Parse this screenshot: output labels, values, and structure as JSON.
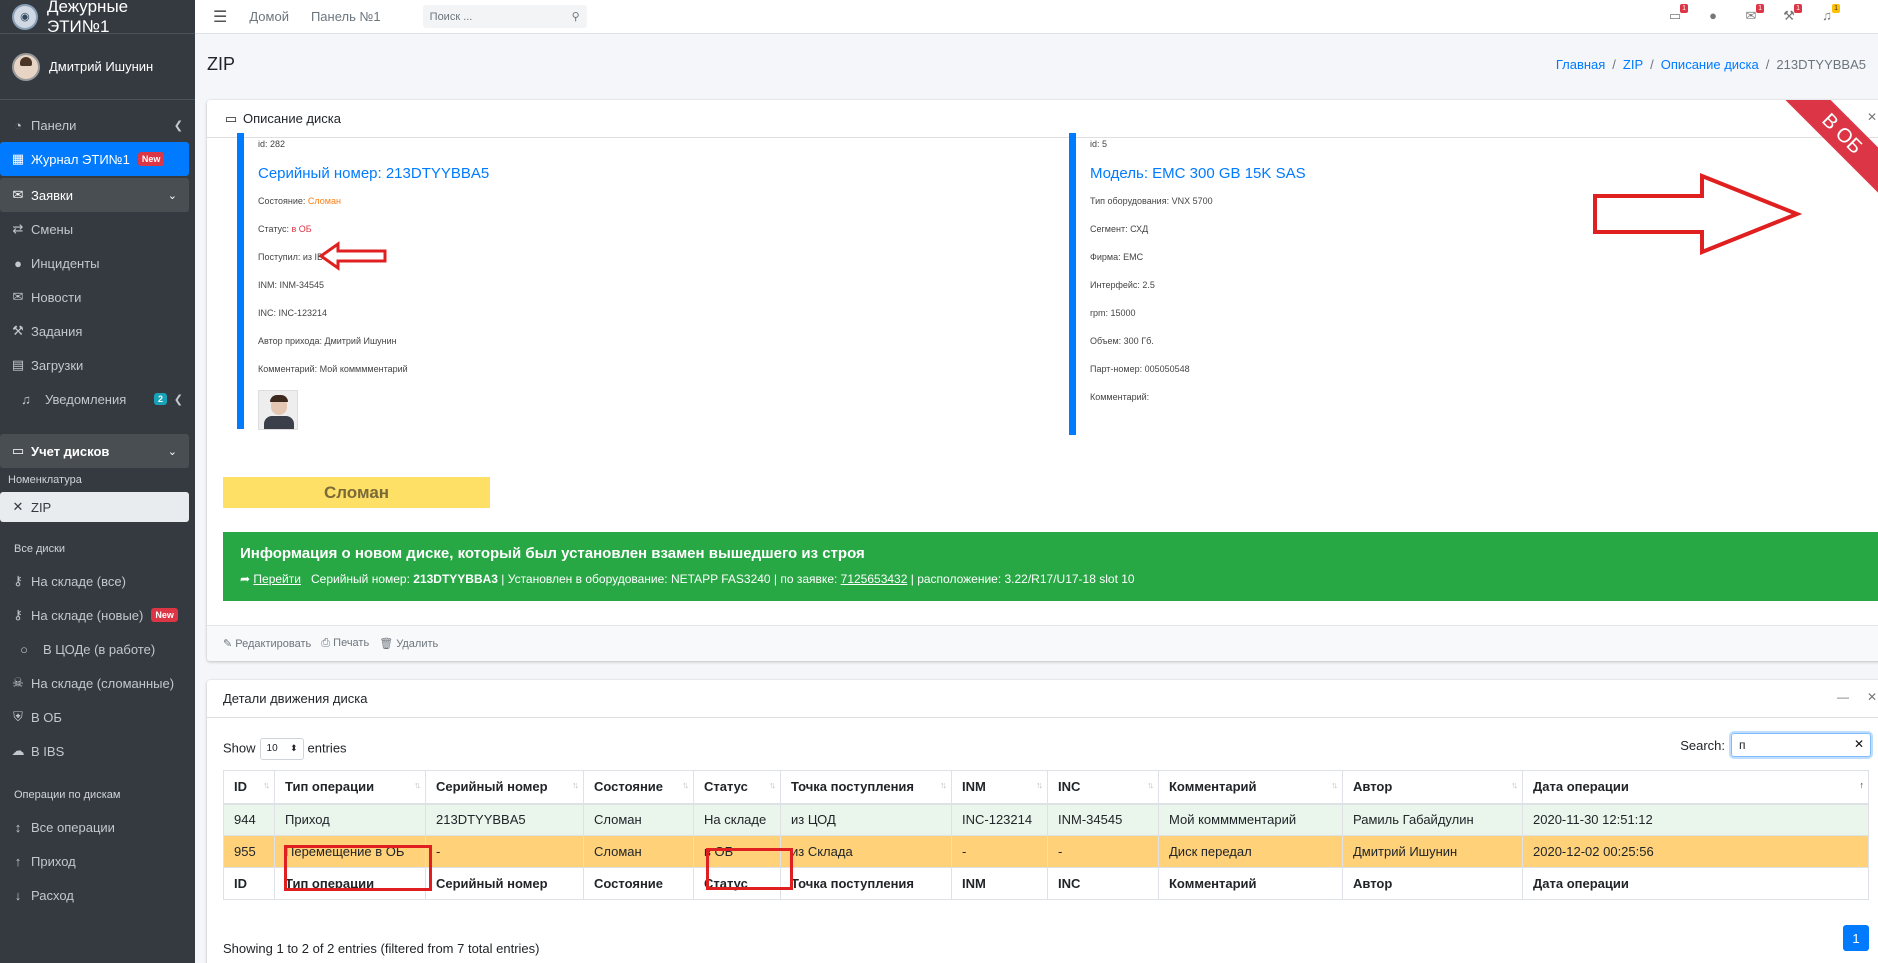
{
  "app": {
    "title": "Дежурные ЭТИ№1",
    "user": "Дмитрий Ишунин"
  },
  "sidebar": {
    "items": [
      {
        "label": "Панели"
      },
      {
        "label": "Журнал ЭТИ№1",
        "badge": "New"
      },
      {
        "label": "Заявки"
      },
      {
        "label": "Смены"
      },
      {
        "label": "Инциденты"
      },
      {
        "label": "Новости"
      },
      {
        "label": "Задания"
      },
      {
        "label": "Загрузки"
      },
      {
        "label": "Уведомления",
        "badge": "2"
      },
      {
        "label": "Учет дисков"
      }
    ],
    "nomenclature_header": "Номенклатура",
    "zip_item": "ZIP",
    "all_disks_header": "Все диски",
    "disk_items": [
      {
        "label": "На складе (все)"
      },
      {
        "label": "На складе (новые)",
        "badge": "New"
      },
      {
        "label": "В ЦОДе (в работе)"
      },
      {
        "label": "На складе (сломанные)"
      },
      {
        "label": "В ОБ"
      },
      {
        "label": "В IBS"
      }
    ],
    "ops_header": "Операции по дискам",
    "ops_items": [
      {
        "label": "Все операции"
      },
      {
        "label": "Приход"
      },
      {
        "label": "Расход"
      }
    ]
  },
  "topbar": {
    "home": "Домой",
    "panel": "Панель №1",
    "search_placeholder": "Поиск ...",
    "badges": [
      "1",
      "1",
      "1",
      "1"
    ]
  },
  "page": {
    "title": "ZIP",
    "breadcrumb": [
      "Главная",
      "ZIP",
      "Описание диска",
      "213DTYYBBA5"
    ]
  },
  "card1": {
    "title": "Описание диска",
    "ribbon": "В ОБ",
    "left": {
      "id": "id: 282",
      "heading": "Серийный номер: 213DTYYBBA5",
      "state_label": "Состояние: ",
      "state_value": "Сломан",
      "status_label": "Статус: ",
      "status_value": "в ОБ",
      "received": "Поступил: из IBS",
      "inm": "INM: INM-34545",
      "inc": "INC: INC-123214",
      "author": "Автор прихода: Дмитрий Ишунин",
      "comment": "Комментарий: Мой комммментарий"
    },
    "right": {
      "id": "id: 5",
      "heading": "Модель: EMC 300 GB 15K SAS",
      "equipment_type": "Тип оборудования: VNX 5700",
      "segment": "Сегмент: СХД",
      "vendor": "Фирма: EMC",
      "interface": "Интерфейс: 2.5",
      "rpm": "rpm: 15000",
      "volume": "Объем: 300 Гб.",
      "part_number": "Парт-номер: 005050548",
      "comment": "Комментарий:"
    },
    "state_button": "Сломан",
    "info": {
      "title": "Информация о новом диске, который был установлен взамен вышедшего из строя",
      "go_link": "Перейти",
      "serial_prefix": "Серийный номер: ",
      "serial": "213DTYYBBA3",
      "installed": " | Установлен в оборудование: NETAPP FAS3240 | по заявке: ",
      "ticket": "7125653432",
      "location": " | расположение: 3.22/R17/U17-18 slot 10"
    },
    "footer": {
      "edit": "Редактировать",
      "print": "Печать",
      "delete": "Удалить"
    }
  },
  "card2": {
    "title": "Детали движения диска",
    "show": "Show",
    "show_value": "10",
    "entries": "entries",
    "search_label": "Search:",
    "search_value": "п",
    "columns": [
      "ID",
      "Тип операции",
      "Серийный номер",
      "Состояние",
      "Статус",
      "Точка поступления",
      "INM",
      "INC",
      "Комментарий",
      "Автор",
      "Дата операции"
    ],
    "rows": [
      [
        "944",
        "Приход",
        "213DTYYBBA5",
        "Сломан",
        "На складе",
        "из ЦОД",
        "INC-123214",
        "INM-34545",
        "Мой комммментарий",
        "Рамиль Габайдулин",
        "2020-11-30 12:51:12"
      ],
      [
        "955",
        "Перемещение в ОБ",
        "-",
        "Сломан",
        "в ОБ",
        "из Склада",
        "-",
        "-",
        "Диск передал",
        "Дмитрий Ишунин",
        "2020-12-02 00:25:56"
      ]
    ],
    "info": "Showing 1 to 2 of 2 entries (filtered from 7 total entries)",
    "page": "1"
  }
}
